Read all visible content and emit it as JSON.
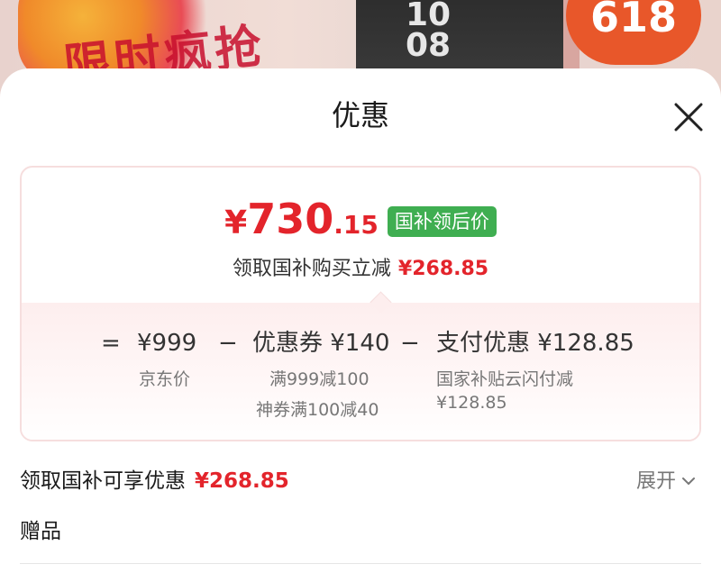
{
  "banner": {
    "left_text": "限时疯抢",
    "watch_time": "10\n08",
    "badge": "618"
  },
  "sheet": {
    "title": "优惠",
    "close_icon": "close-icon"
  },
  "price_card": {
    "final_price": {
      "currency": "¥",
      "integer": "730",
      "decimal": ".15"
    },
    "price_tag": "国补领后价",
    "discount_text": "领取国补购买立减",
    "discount_amount": "¥268.85",
    "formula": {
      "eq": "=",
      "base_price": "¥999",
      "base_label": "京东价",
      "minus1": "−",
      "coupon": "优惠券 ¥140",
      "coupon_detail_1": "满999减100",
      "coupon_detail_2": "神券满100减40",
      "minus2": "−",
      "payment": "支付优惠 ¥128.85",
      "payment_detail_1": "国家补贴云闪付减",
      "payment_detail_2": "¥128.85"
    }
  },
  "subsidy_row": {
    "label": "领取国补可享优惠",
    "amount": "¥268.85",
    "expand_label": "展开",
    "expand_icon": "chevron-down-icon"
  },
  "gift_row": {
    "label": "赠品"
  },
  "colors": {
    "price_red": "#e3242b",
    "tag_green": "#3fae51",
    "card_border": "#f6dede"
  }
}
